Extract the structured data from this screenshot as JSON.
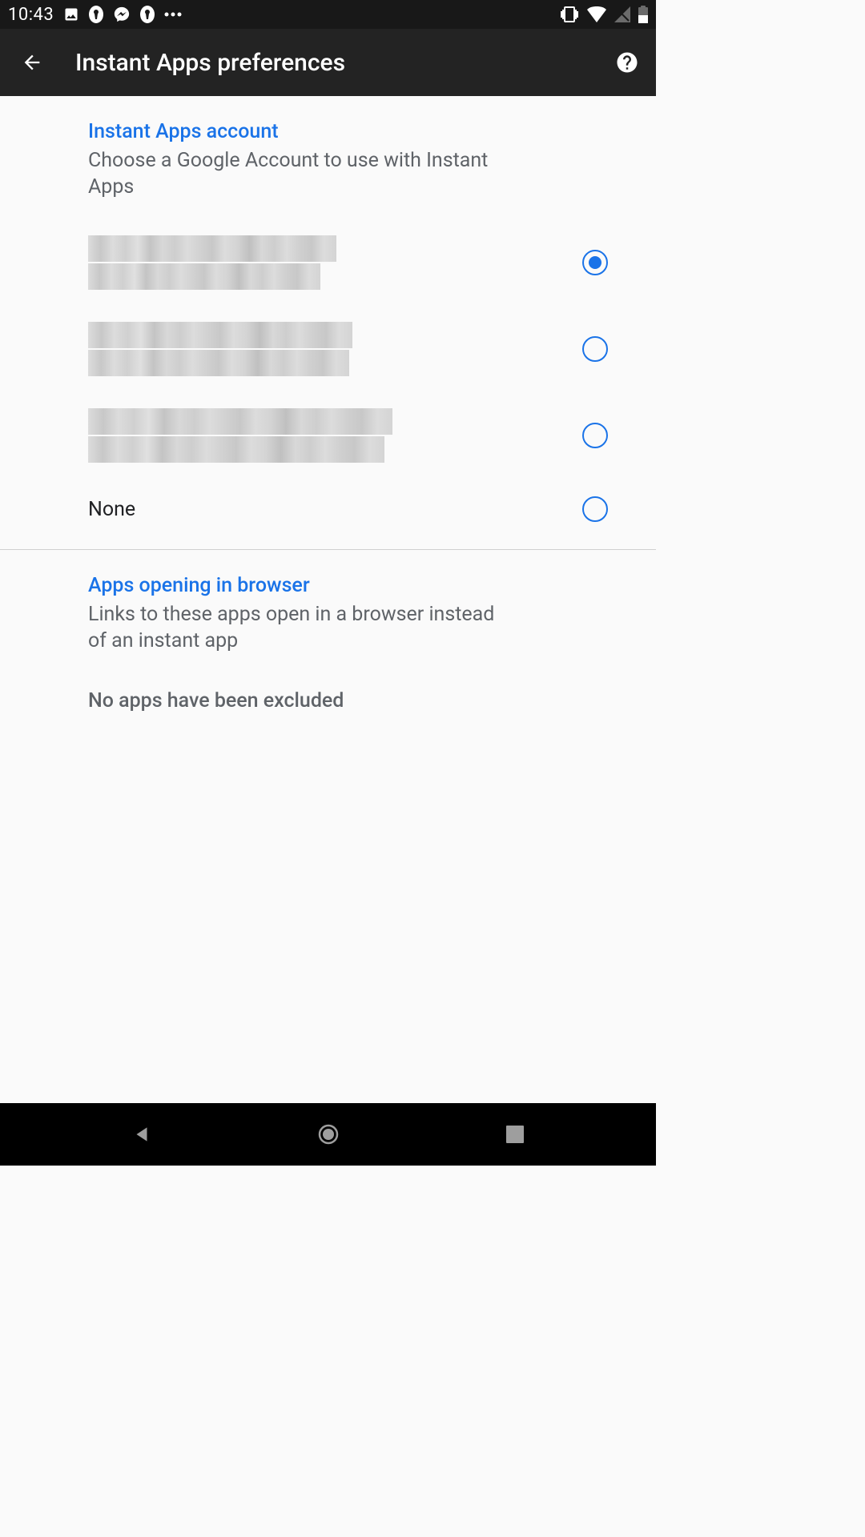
{
  "status": {
    "time": "10:43"
  },
  "header": {
    "title": "Instant Apps preferences"
  },
  "sections": {
    "account": {
      "title": "Instant Apps account",
      "subtitle": "Choose a Google Account to use with Instant Apps",
      "options": {
        "opt0": {
          "selected": true,
          "redacted": true
        },
        "opt1": {
          "selected": false,
          "redacted": true
        },
        "opt2": {
          "selected": false,
          "redacted": true
        },
        "none": {
          "label": "None",
          "selected": false
        }
      }
    },
    "browser": {
      "title": "Apps opening in browser",
      "subtitle": "Links to these apps open in a browser instead of an instant app",
      "empty": "No apps have been excluded"
    }
  }
}
